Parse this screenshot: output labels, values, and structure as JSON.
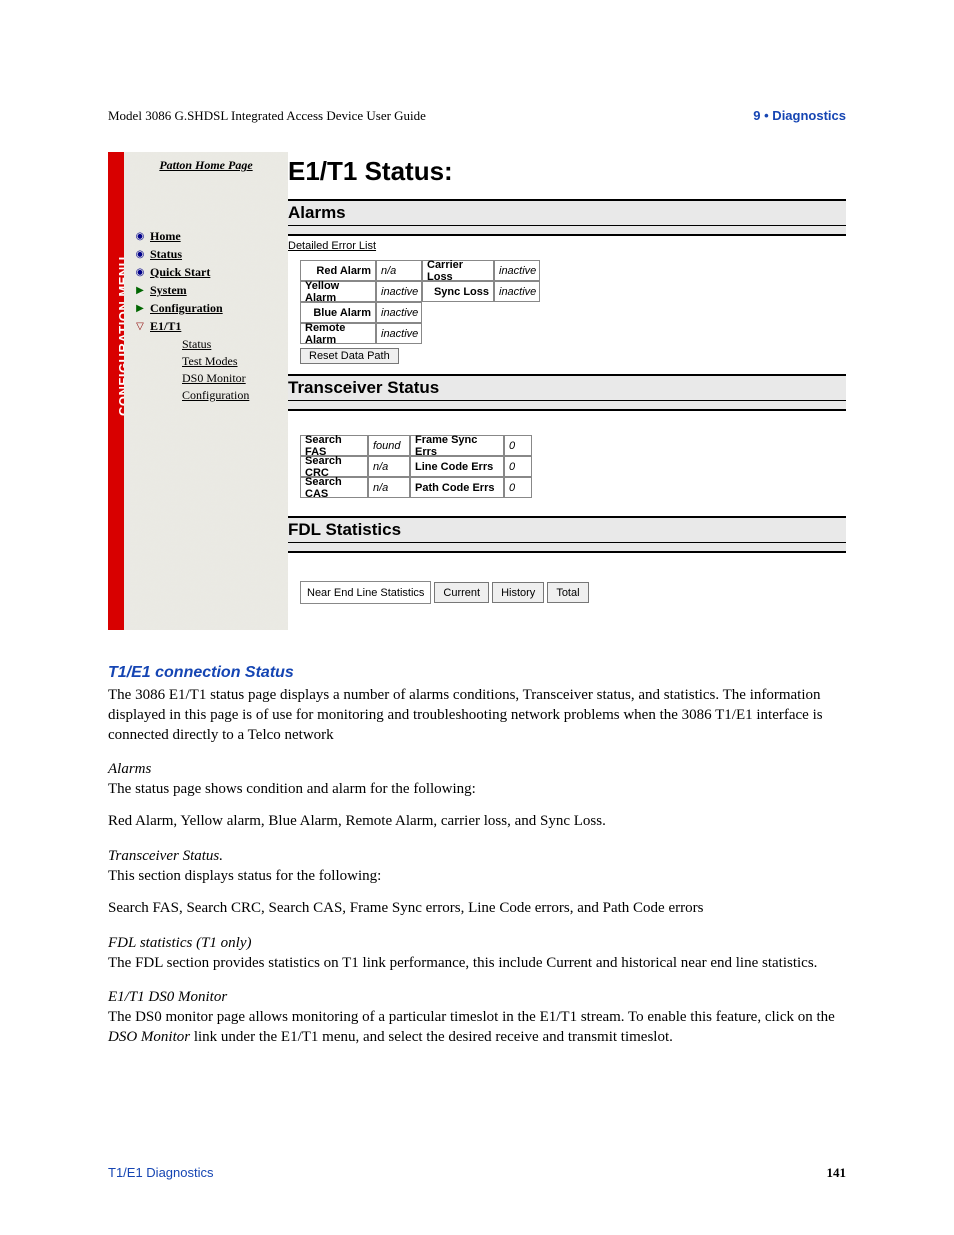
{
  "header": {
    "left": "Model 3086 G.SHDSL Integrated Access Device User Guide",
    "right": "9 • Diagnostics"
  },
  "screenshot": {
    "configLabel": "CONFIGURATION MENU",
    "homeLink": "Patton Home Page",
    "menu": [
      {
        "icon": "circle",
        "label": "Home",
        "bold": true
      },
      {
        "icon": "circle",
        "label": "Status",
        "bold": true
      },
      {
        "icon": "circle",
        "label": "Quick Start",
        "bold": true
      },
      {
        "icon": "tri",
        "label": "System",
        "bold": true
      },
      {
        "icon": "tri",
        "label": "Configuration",
        "bold": true
      },
      {
        "icon": "triopen",
        "label": "E1/T1",
        "bold": true
      }
    ],
    "submenu": [
      "Status",
      "Test Modes",
      "DS0 Monitor",
      "Configuration"
    ],
    "pageTitle": "E1/T1 Status:",
    "alarms": {
      "title": "Alarms",
      "detailLink": "Detailed Error List",
      "rows": [
        {
          "l1": "Red Alarm",
          "v1": "n/a",
          "l2": "Carrier Loss",
          "v2": "inactive"
        },
        {
          "l1": "Yellow Alarm",
          "v1": "inactive",
          "l2": "Sync Loss",
          "v2": "inactive"
        },
        {
          "l1": "Blue Alarm",
          "v1": "inactive"
        },
        {
          "l1": "Remote Alarm",
          "v1": "inactive"
        }
      ],
      "resetBtn": "Reset Data Path"
    },
    "transceiver": {
      "title": "Transceiver Status",
      "rows": [
        {
          "l1": "Search FAS",
          "v1": "found",
          "l2": "Frame Sync Errs",
          "v2": "0"
        },
        {
          "l1": "Search CRC",
          "v1": "n/a",
          "l2": "Line Code Errs",
          "v2": "0"
        },
        {
          "l1": "Search CAS",
          "v1": "n/a",
          "l2": "Path Code Errs",
          "v2": "0"
        }
      ]
    },
    "fdl": {
      "title": "FDL Statistics",
      "label": "Near End Line Statistics",
      "buttons": [
        "Current",
        "History",
        "Total"
      ]
    }
  },
  "doc": {
    "h_blue": "T1/E1 connection Status",
    "p1": "The 3086 E1/T1 status page displays a number of alarms conditions, Transceiver status, and statistics. The information displayed in this page is of use for monitoring and troubleshooting network problems when the 3086 T1/E1 interface is connected directly to a Telco network",
    "h_alarms": "Alarms",
    "p2": "The status page shows condition and alarm for the following:",
    "p3": "Red Alarm, Yellow alarm, Blue Alarm, Remote Alarm, carrier loss, and Sync Loss.",
    "h_trans": "Transceiver Status.",
    "p4": "This section displays status for the following:",
    "p5": "Search FAS, Search CRC, Search CAS, Frame Sync errors, Line Code errors, and Path Code errors",
    "h_fdl": "FDL statistics (T1 only)",
    "p6": "The FDL section provides  statistics on T1 link performance, this include Current and historical near end line statistics.",
    "h_ds0": "E1/T1 DS0 Monitor",
    "p7a": "The DS0 monitor page allows monitoring of a particular timeslot in the E1/T1 stream. To enable this feature, click on the ",
    "p7b": "DSO Monitor",
    "p7c": " link under the E1/T1 menu, and select the desired receive and transmit timeslot."
  },
  "footer": {
    "left": "T1/E1 Diagnostics",
    "right": "141"
  }
}
